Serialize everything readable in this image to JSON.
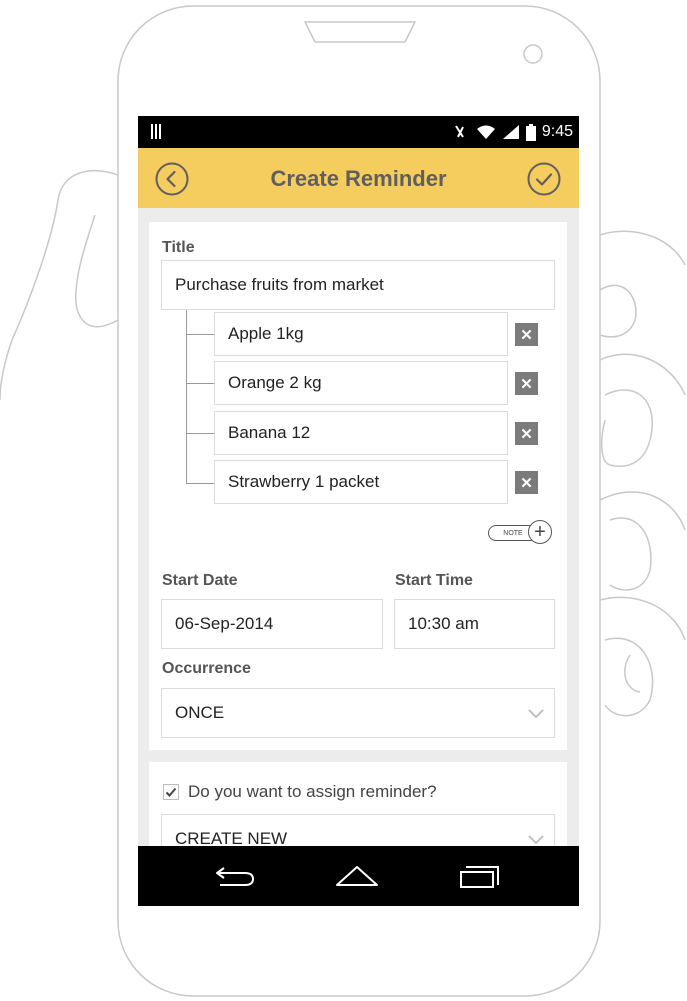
{
  "status_bar": {
    "time": "9:45"
  },
  "app_bar": {
    "title": "Create Reminder"
  },
  "form": {
    "title_label": "Title",
    "title_value": "Purchase fruits from market",
    "items": [
      {
        "label": "Apple 1kg",
        "delete_glyph": "✕"
      },
      {
        "label": "Orange 2 kg",
        "delete_glyph": "✕"
      },
      {
        "label": "Banana 12",
        "delete_glyph": "✕"
      },
      {
        "label": "Strawberry 1 packet",
        "delete_glyph": "✕"
      }
    ],
    "note_button_label": "NOTE",
    "start_date_label": "Start Date",
    "start_date_value": "06-Sep-2014",
    "start_time_label": "Start Time",
    "start_time_value": "10:30 am",
    "occurrence_label": "Occurrence",
    "occurrence_value": "ONCE"
  },
  "assign": {
    "checkbox_label": "Do you want to assign reminder?",
    "checked": true,
    "select_value": "CREATE NEW"
  },
  "colors": {
    "app_bar": "#f5cc5e",
    "status_bar": "#000000",
    "nav_bar": "#000000",
    "delete_button": "#7b7b7b"
  },
  "icons": [
    "back-icon",
    "check-circle-icon",
    "close-icon",
    "plus-icon",
    "chevron-down-icon",
    "nav-back-icon",
    "nav-home-icon",
    "nav-recents-icon",
    "wifi-icon",
    "signal-icon",
    "battery-icon",
    "mute-icon"
  ]
}
